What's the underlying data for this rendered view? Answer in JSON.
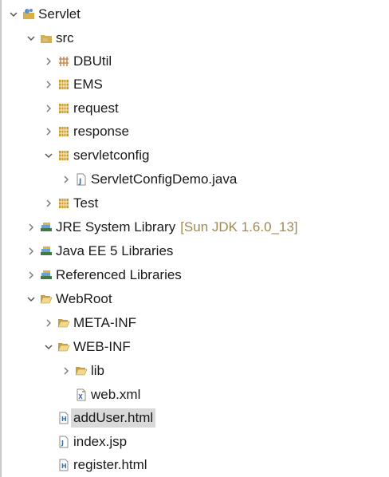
{
  "tree": [
    {
      "label": "Servlet",
      "qualifier": "",
      "expanded": true,
      "icon": "project-icon",
      "selected": false
    },
    {
      "label": "src",
      "qualifier": "",
      "expanded": true,
      "icon": "source-folder-icon",
      "selected": false
    },
    {
      "label": "DBUtil",
      "qualifier": "",
      "expanded": false,
      "icon": "empty-package-icon",
      "selected": false
    },
    {
      "label": "EMS",
      "qualifier": "",
      "expanded": false,
      "icon": "package-icon",
      "selected": false
    },
    {
      "label": "request",
      "qualifier": "",
      "expanded": false,
      "icon": "package-icon",
      "selected": false
    },
    {
      "label": "response",
      "qualifier": "",
      "expanded": false,
      "icon": "package-icon",
      "selected": false
    },
    {
      "label": "servletconfig",
      "qualifier": "",
      "expanded": true,
      "icon": "package-icon",
      "selected": false
    },
    {
      "label": "ServletConfigDemo.java",
      "qualifier": "",
      "expanded": false,
      "icon": "java-file-icon",
      "selected": false
    },
    {
      "label": "Test",
      "qualifier": "",
      "expanded": false,
      "icon": "package-icon",
      "selected": false
    },
    {
      "label": "JRE System Library",
      "qualifier": "[Sun JDK 1.6.0_13]",
      "expanded": false,
      "icon": "library-icon",
      "selected": false
    },
    {
      "label": "Java EE 5 Libraries",
      "qualifier": "",
      "expanded": false,
      "icon": "library-icon",
      "selected": false
    },
    {
      "label": "Referenced Libraries",
      "qualifier": "",
      "expanded": false,
      "icon": "library-icon",
      "selected": false
    },
    {
      "label": "WebRoot",
      "qualifier": "",
      "expanded": true,
      "icon": "folder-open-icon",
      "selected": false
    },
    {
      "label": "META-INF",
      "qualifier": "",
      "expanded": false,
      "icon": "folder-open-icon",
      "selected": false
    },
    {
      "label": "WEB-INF",
      "qualifier": "",
      "expanded": true,
      "icon": "folder-open-icon",
      "selected": false
    },
    {
      "label": "lib",
      "qualifier": "",
      "expanded": false,
      "icon": "folder-open-icon",
      "selected": false
    },
    {
      "label": "web.xml",
      "qualifier": "",
      "expanded": null,
      "icon": "xml-file-icon",
      "selected": false
    },
    {
      "label": "addUser.html",
      "qualifier": "",
      "expanded": null,
      "icon": "html-file-icon",
      "selected": true
    },
    {
      "label": "index.jsp",
      "qualifier": "",
      "expanded": null,
      "icon": "jsp-file-icon",
      "selected": false
    },
    {
      "label": "register.html",
      "qualifier": "",
      "expanded": null,
      "icon": "html-file-icon",
      "selected": false
    }
  ],
  "colors": {
    "qualifier": "#a08a52",
    "selection": "#d9d9d9",
    "package": "#b8860b",
    "folder": "#d8b04a",
    "library": "#3f7a3f"
  }
}
